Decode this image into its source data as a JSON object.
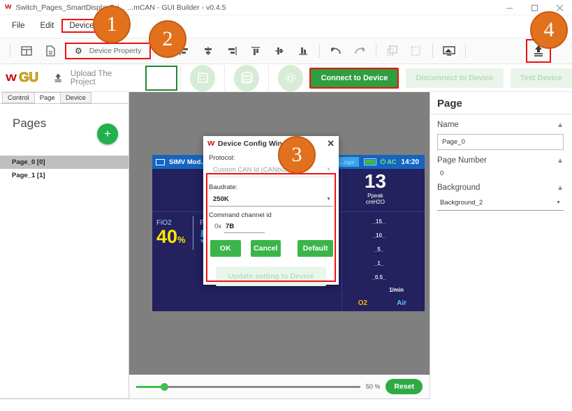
{
  "window": {
    "title": "Switch_Pages_SmartDisplay7vi...   ...mCAN - GUI Builder - v0.4.5",
    "logo": "W",
    "minimize": "minimize-icon",
    "maximize": "maximize-icon",
    "close": "close-icon"
  },
  "menu": {
    "items": [
      {
        "label": "File",
        "highlight": false
      },
      {
        "label": "Edit",
        "highlight": false
      },
      {
        "label": "Device",
        "highlight": true
      },
      {
        "label": "...ator",
        "highlight": false
      }
    ]
  },
  "toolbar1": {
    "device_property": "Device Property",
    "gear": "⚙"
  },
  "toolbar2": {
    "brand_w": "W",
    "brand_gu": "GU",
    "upload_project": "Upload The Project",
    "connect": "Connect to Device",
    "disconnect": "Disconnect to Device",
    "test": "Test Device"
  },
  "left_panel": {
    "tabs": [
      {
        "label": "Control",
        "active": false
      },
      {
        "label": "Page",
        "active": true
      },
      {
        "label": "Device",
        "active": false
      }
    ],
    "heading": "Pages",
    "add_label": "+",
    "pages": [
      {
        "label": "Page_0 [0]",
        "selected": true
      },
      {
        "label": "Page_1 [1]",
        "selected": false
      }
    ]
  },
  "device_preview": {
    "mode": "SIMV Mod...",
    "settings_tab": "...ngs",
    "ac": "AC",
    "time": "14:20",
    "ppeak_value": "13",
    "ppeak_label": "Ppeak",
    "ppeak_unit": "cmH2O",
    "fio2_label": "FiO2",
    "fio2_value": "40",
    "fio2_unit": "%",
    "peep_label": "PE...",
    "peep_value": "5",
    "scale_ticks": [
      "_15_",
      "_10_",
      "_5_",
      "_1_",
      "_0.5_"
    ],
    "flow_unit": "1/min",
    "o2_label": "O2",
    "air_label": "Air"
  },
  "dialog": {
    "title": "Device Config Window",
    "logo": "W",
    "close": "✕",
    "protocol_label": "Protocol:",
    "protocol_value": "Custom CAN Id (CANbus)",
    "baudrate_label": "Baudrate:",
    "baudrate_value": "250K",
    "channel_label": "Command channel id",
    "channel_prefix": "0x",
    "channel_value": "7B",
    "ok": "OK",
    "cancel": "Cancel",
    "default": "Default",
    "update": "Update setting to Device"
  },
  "right_panel": {
    "title": "Page",
    "name_label": "Name",
    "name_value": "Page_0",
    "page_number_label": "Page Number",
    "page_number_value": "0",
    "background_label": "Background",
    "background_value": "Background_2"
  },
  "zoombar": {
    "value": "50 %",
    "reset": "Reset"
  },
  "markers": [
    {
      "label": "1"
    },
    {
      "label": "2"
    },
    {
      "label": "3"
    },
    {
      "label": "4"
    }
  ],
  "colors": {
    "accent_green": "#2e9e3e",
    "marker_orange": "#e2711d",
    "highlight_red": "#ee1111",
    "device_blue": "#23215e",
    "brand_red": "#c00d0d"
  }
}
